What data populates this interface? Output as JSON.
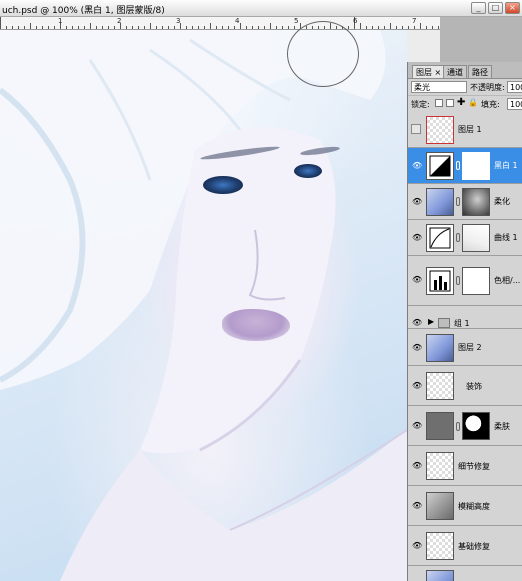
{
  "window": {
    "title": "uch.psd @ 100% (黑白 1, 图层蒙版/8)",
    "buttons": {
      "minimize": "_",
      "restore": "□",
      "close": "×"
    }
  },
  "ruler": {
    "labels": [
      "1",
      "2",
      "3",
      "4",
      "5",
      "6",
      "7",
      "8"
    ]
  },
  "layers_panel": {
    "tabs": [
      {
        "label": "图层 ×",
        "active": true
      },
      {
        "label": "通道",
        "active": false
      },
      {
        "label": "路径",
        "active": false
      }
    ],
    "blend_mode": "柔光",
    "opacity_label": "不透明度:",
    "opacity_value": "100%",
    "lock_label": "锁定:",
    "fill_label": "填充:",
    "fill_value": "100%",
    "layers": [
      {
        "name": "图层 1",
        "visible": false,
        "thumb": "transparent",
        "mask": null,
        "selected": false
      },
      {
        "name": "黑白 1",
        "visible": true,
        "thumb": "adjustment-bw",
        "mask": "white",
        "selected": true
      },
      {
        "name": "柔化",
        "visible": true,
        "thumb": "photo",
        "mask": "dark",
        "selected": false
      },
      {
        "name": "曲线 1",
        "visible": true,
        "thumb": "adjustment-curves",
        "mask": "gradient",
        "selected": false
      },
      {
        "name": "色相/...",
        "visible": true,
        "thumb": "adjustment-hue",
        "mask": "white",
        "selected": false
      },
      {
        "name": "组 1",
        "visible": true,
        "type": "group"
      },
      {
        "name": "图层 2",
        "visible": true,
        "thumb": "photo",
        "mask": null,
        "selected": false
      },
      {
        "name": "装饰",
        "visible": true,
        "thumb": "transparent",
        "mask": null,
        "selected": false
      },
      {
        "name": "柔肤",
        "visible": true,
        "thumb": "dark",
        "mask": "bw",
        "selected": false
      },
      {
        "name": "细节修复",
        "visible": true,
        "thumb": "transparent",
        "mask": null,
        "selected": false
      },
      {
        "name": "模糊高度",
        "visible": true,
        "thumb": "gray",
        "mask": null,
        "selected": false
      },
      {
        "name": "基础修复",
        "visible": true,
        "thumb": "transparent",
        "mask": null,
        "selected": false
      }
    ]
  },
  "colors": {
    "selection_blue": "#3a8ee6",
    "panel_gray": "#d4d4d4"
  }
}
